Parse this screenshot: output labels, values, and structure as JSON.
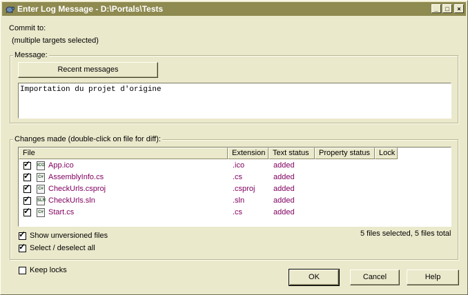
{
  "window": {
    "title": "Enter Log Message - D:\\Portals\\Tests"
  },
  "commit": {
    "label": "Commit to:",
    "targets": "(multiple targets selected)"
  },
  "message": {
    "legend": "Message:",
    "recent_button": "Recent messages",
    "text": "Importation du projet d'origine"
  },
  "changes": {
    "legend": "Changes made (double-click on file for diff):",
    "columns": [
      "File",
      "Extension",
      "Text status",
      "Property status",
      "Lock"
    ],
    "files": [
      {
        "name": "App.ico",
        "ext": ".ico",
        "status": "added",
        "checked": true,
        "icon": "ico-file-icon"
      },
      {
        "name": "AssemblyInfo.cs",
        "ext": ".cs",
        "status": "added",
        "checked": true,
        "icon": "cs-file-icon"
      },
      {
        "name": "CheckUrls.csproj",
        "ext": ".csproj",
        "status": "added",
        "checked": true,
        "icon": "csproj-file-icon"
      },
      {
        "name": "CheckUrls.sln",
        "ext": ".sln",
        "status": "added",
        "checked": true,
        "icon": "sln-file-icon"
      },
      {
        "name": "Start.cs",
        "ext": ".cs",
        "status": "added",
        "checked": true,
        "icon": "cs-file-icon"
      }
    ],
    "show_unversioned": "Show unversioned files",
    "select_all": "Select / deselect all",
    "summary": "5 files selected, 5 files total"
  },
  "keep_locks": "Keep locks",
  "buttons": {
    "ok": "OK",
    "cancel": "Cancel",
    "help": "Help"
  },
  "colors": {
    "title_bar": "#8e8a50",
    "dialog_bg": "#ebe9cc",
    "file_text": "#800060"
  }
}
